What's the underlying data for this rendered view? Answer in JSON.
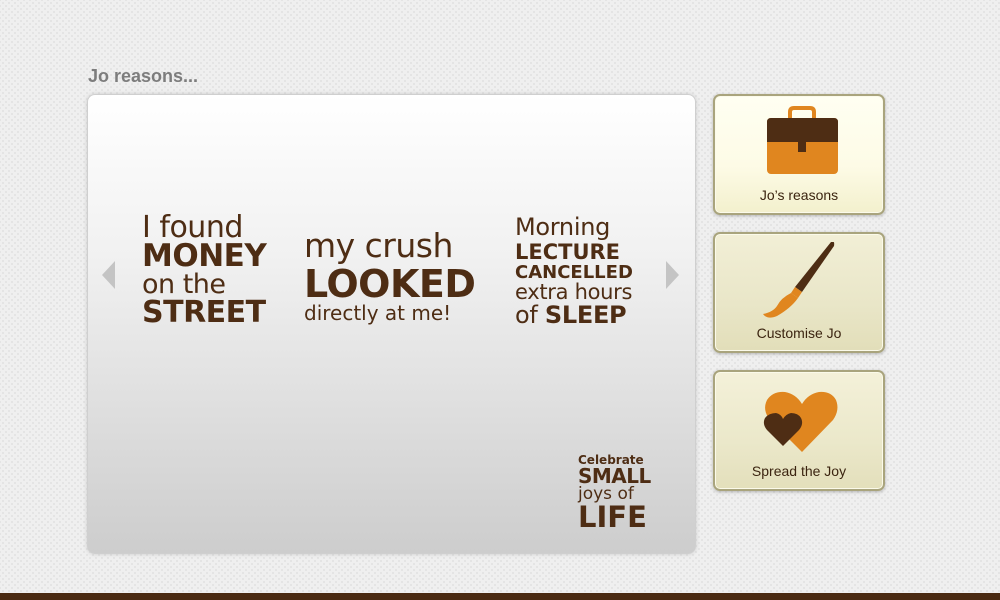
{
  "section": {
    "heading": "Jo reasons..."
  },
  "reasons": [
    {
      "lines": [
        "I found",
        "MONEY",
        "on the",
        "STREET"
      ]
    },
    {
      "lines": [
        "my crush",
        "LOOKED",
        "directly at me!"
      ]
    },
    {
      "lines": [
        "Morning",
        "LECTURE",
        "CANCELLED",
        "extra hours",
        "of",
        "SLEEP"
      ]
    }
  ],
  "logo": {
    "lines": [
      "Celebrate",
      "SMALL",
      "joys of",
      "LIFE"
    ]
  },
  "tiles": [
    {
      "label": "Jo’s reasons",
      "icon": "briefcase-icon"
    },
    {
      "label": "Customise Jo",
      "icon": "paintbrush-icon"
    },
    {
      "label": "Spread the Joy",
      "icon": "hearts-icon"
    }
  ],
  "colors": {
    "text_brown": "#4e2d14",
    "accent_orange": "#e0861f",
    "footer": "#4a2a12"
  }
}
